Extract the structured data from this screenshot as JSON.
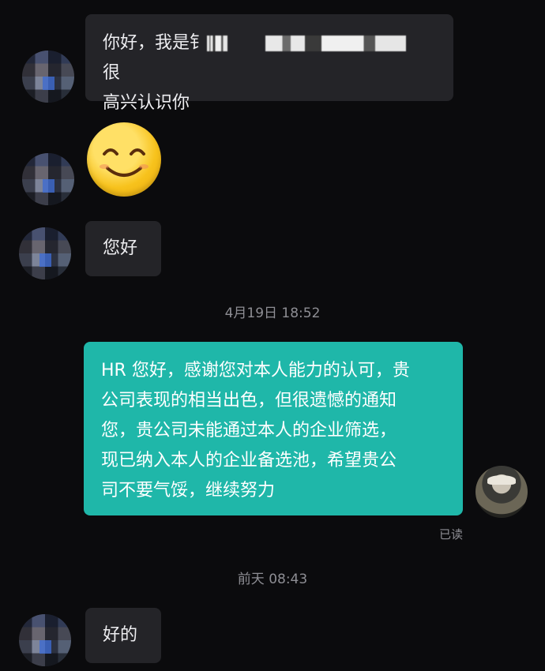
{
  "messages": {
    "m1": {
      "line1_start": "你好，我是",
      "line1_partial": "钅",
      "line1_end": "很",
      "line2": "高兴认识你"
    },
    "m2": {
      "emoji": "smiling-face-emoji"
    },
    "m3": {
      "text": "您好"
    },
    "m4": {
      "lines": [
        "HR 您好，感谢您对本人能力的认可，贵",
        "公司表现的相当出色，但很遗憾的通知",
        "您，贵公司未能通过本人的企业筛选，",
        "现已纳入本人的企业备选池，希望贵公",
        "司不要气馁，继续努力"
      ],
      "status": "已读"
    },
    "m5": {
      "text": "好的"
    }
  },
  "timestamps": {
    "t1": "4月19日 18:52",
    "t2": "前天 08:43"
  },
  "colors": {
    "background": "#0b0b0d",
    "incoming_bubble": "#242428",
    "outgoing_bubble": "#1fb7a9",
    "timestamp_text": "#8e8e94"
  }
}
